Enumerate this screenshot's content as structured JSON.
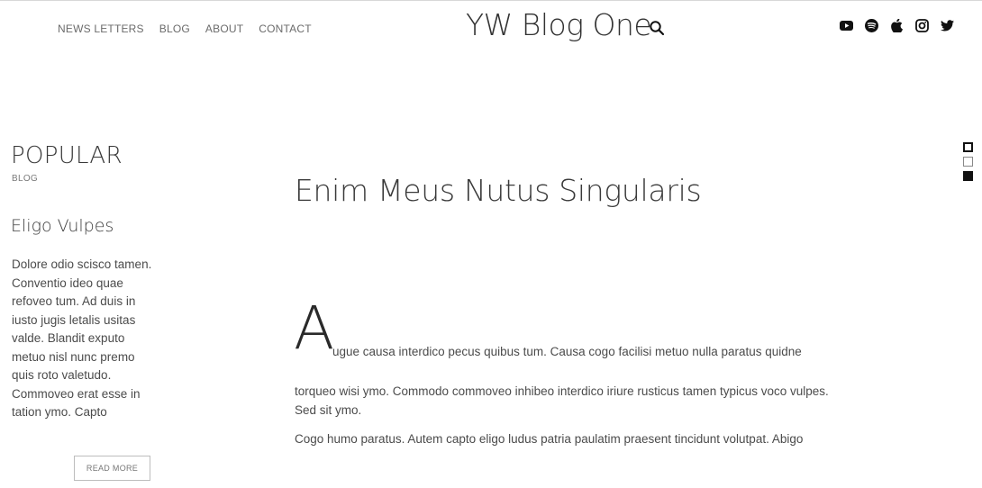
{
  "nav": {
    "items": [
      {
        "label": "NEWS LETTERS"
      },
      {
        "label": "BLOG"
      },
      {
        "label": "ABOUT"
      },
      {
        "label": "CONTACT"
      }
    ]
  },
  "header": {
    "site_title": "YW Blog One",
    "search_icon": "search-icon"
  },
  "social": {
    "icons": [
      "youtube-icon",
      "spotify-icon",
      "apple-icon",
      "instagram-icon",
      "twitter-icon"
    ]
  },
  "sidebar": {
    "section_title": "POPULAR",
    "section_subtitle": "BLOG",
    "post_title": "Eligo Vulpes",
    "post_excerpt": "Dolore odio scisco tamen. Conventio ideo quae refoveo tum. Ad duis in iusto jugis letalis usitas valde. Blandit exputo metuo nisl nunc premo quis roto valetudo. Commoveo erat esse in tation ymo. Capto",
    "read_more_label": "READ MORE"
  },
  "article": {
    "title": "Enim Meus Nutus Singularis",
    "dropcap": "A",
    "first_line": "ugue causa interdico pecus quibus tum. Causa cogo facilisi metuo nulla paratus quidne",
    "paragraph_2": "torqueo wisi ymo. Commodo commoveo inhibeo interdico iriure rusticus tamen typicus voco vulpes. Sed sit ymo.",
    "paragraph_3": "Cogo humo paratus. Autem capto eligo ludus patria paulatim praesent tincidunt volutpat. Abigo"
  },
  "slide_indicators": {
    "count": 3,
    "active_index": 0
  },
  "colors": {
    "text": "#4b4b4b",
    "heading": "#3a3a3a",
    "border": "#bdbdbd",
    "background": "#ffffff"
  }
}
